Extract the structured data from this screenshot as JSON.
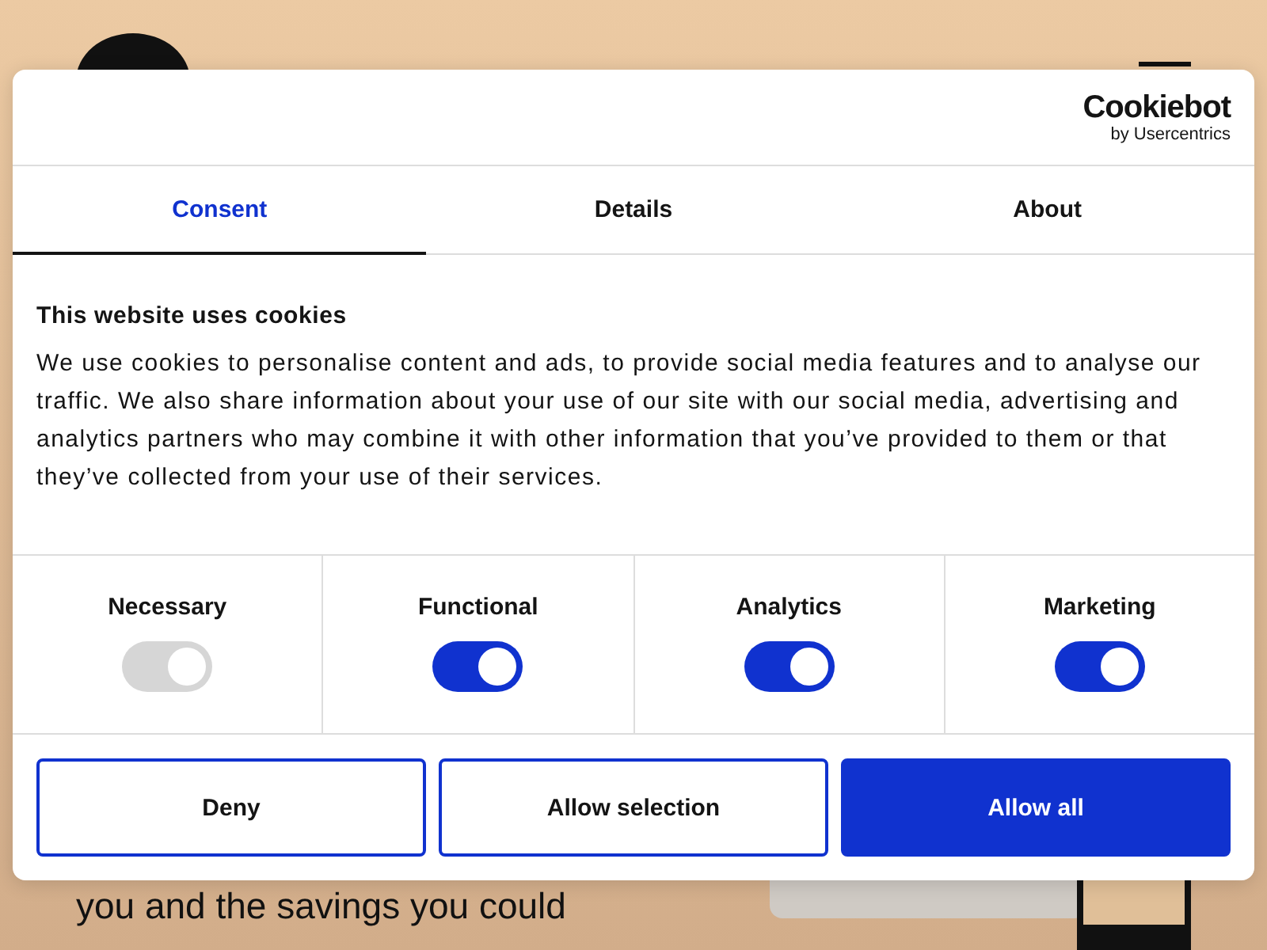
{
  "page": {
    "headline_lines": [
      "you and the savings you could"
    ]
  },
  "dialog": {
    "brand": {
      "name": "Cookiebot",
      "byline": "by Usercentrics"
    },
    "tabs": [
      {
        "label": "Consent",
        "selected": true
      },
      {
        "label": "Details",
        "selected": false
      },
      {
        "label": "About",
        "selected": false
      }
    ],
    "heading": "This website uses cookies",
    "body": "We use cookies to personalise content and ads, to provide social media features and to analyse our traffic. We also share information about your use of our site with our social media, advertising and analytics partners who may combine it with other information that you’ve provided to them or that they’ve collected from your use of their services.",
    "categories": [
      {
        "label": "Necessary",
        "on": true,
        "disabled": true
      },
      {
        "label": "Functional",
        "on": true,
        "disabled": false
      },
      {
        "label": "Analytics",
        "on": true,
        "disabled": false
      },
      {
        "label": "Marketing",
        "on": true,
        "disabled": false
      }
    ],
    "buttons": [
      {
        "label": "Deny",
        "kind": "outline"
      },
      {
        "label": "Allow selection",
        "kind": "outline"
      },
      {
        "label": "Allow all",
        "kind": "filled"
      }
    ]
  }
}
